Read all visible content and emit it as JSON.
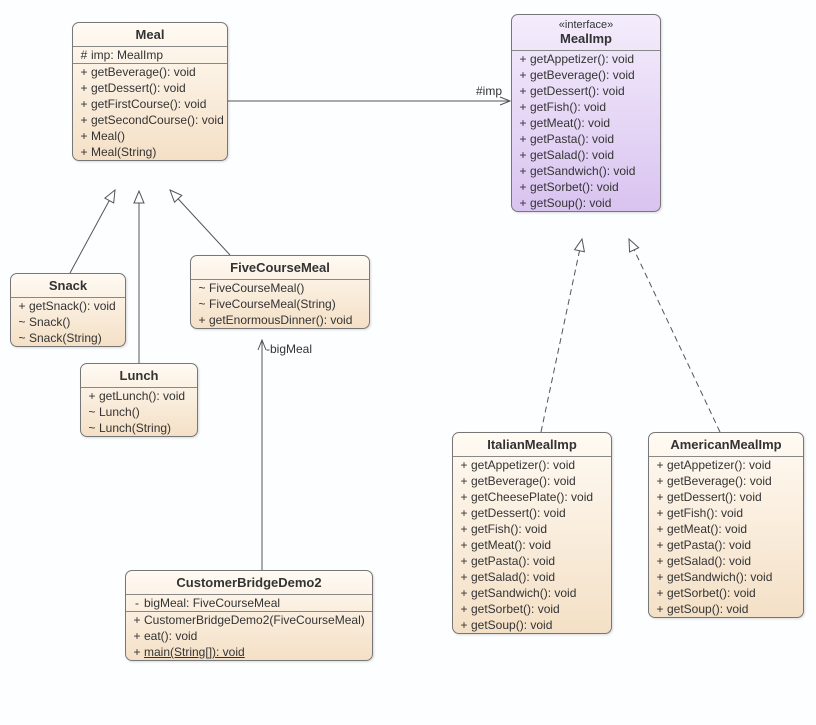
{
  "classes": {
    "meal": {
      "name": "Meal",
      "attrs": [
        {
          "vis": "#",
          "sig": "imp: MealImp"
        }
      ],
      "ops": [
        {
          "vis": "+",
          "sig": "getBeverage(): void"
        },
        {
          "vis": "+",
          "sig": "getDessert(): void"
        },
        {
          "vis": "+",
          "sig": "getFirstCourse(): void"
        },
        {
          "vis": "+",
          "sig": "getSecondCourse(): void"
        },
        {
          "vis": "+",
          "sig": "Meal()"
        },
        {
          "vis": "+",
          "sig": "Meal(String)"
        }
      ]
    },
    "mealimp": {
      "stereotype": "«interface»",
      "name": "MealImp",
      "ops": [
        {
          "vis": "+",
          "sig": "getAppetizer(): void"
        },
        {
          "vis": "+",
          "sig": "getBeverage(): void"
        },
        {
          "vis": "+",
          "sig": "getDessert(): void"
        },
        {
          "vis": "+",
          "sig": "getFish(): void"
        },
        {
          "vis": "+",
          "sig": "getMeat(): void"
        },
        {
          "vis": "+",
          "sig": "getPasta(): void"
        },
        {
          "vis": "+",
          "sig": "getSalad(): void"
        },
        {
          "vis": "+",
          "sig": "getSandwich(): void"
        },
        {
          "vis": "+",
          "sig": "getSorbet(): void"
        },
        {
          "vis": "+",
          "sig": "getSoup(): void"
        }
      ]
    },
    "snack": {
      "name": "Snack",
      "ops": [
        {
          "vis": "+",
          "sig": "getSnack(): void"
        },
        {
          "vis": "~",
          "sig": "Snack()"
        },
        {
          "vis": "~",
          "sig": "Snack(String)"
        }
      ]
    },
    "fivecoursemeal": {
      "name": "FiveCourseMeal",
      "ops": [
        {
          "vis": "~",
          "sig": "FiveCourseMeal()"
        },
        {
          "vis": "~",
          "sig": "FiveCourseMeal(String)"
        },
        {
          "vis": "+",
          "sig": "getEnormousDinner(): void"
        }
      ]
    },
    "lunch": {
      "name": "Lunch",
      "ops": [
        {
          "vis": "+",
          "sig": "getLunch(): void"
        },
        {
          "vis": "~",
          "sig": "Lunch()"
        },
        {
          "vis": "~",
          "sig": "Lunch(String)"
        }
      ]
    },
    "italian": {
      "name": "ItalianMealImp",
      "ops": [
        {
          "vis": "+",
          "sig": "getAppetizer(): void"
        },
        {
          "vis": "+",
          "sig": "getBeverage(): void"
        },
        {
          "vis": "+",
          "sig": "getCheesePlate(): void"
        },
        {
          "vis": "+",
          "sig": "getDessert(): void"
        },
        {
          "vis": "+",
          "sig": "getFish(): void"
        },
        {
          "vis": "+",
          "sig": "getMeat(): void"
        },
        {
          "vis": "+",
          "sig": "getPasta(): void"
        },
        {
          "vis": "+",
          "sig": "getSalad(): void"
        },
        {
          "vis": "+",
          "sig": "getSandwich(): void"
        },
        {
          "vis": "+",
          "sig": "getSorbet(): void"
        },
        {
          "vis": "+",
          "sig": "getSoup(): void"
        }
      ]
    },
    "american": {
      "name": "AmericanMealImp",
      "ops": [
        {
          "vis": "+",
          "sig": "getAppetizer(): void"
        },
        {
          "vis": "+",
          "sig": "getBeverage(): void"
        },
        {
          "vis": "+",
          "sig": "getDessert(): void"
        },
        {
          "vis": "+",
          "sig": "getFish(): void"
        },
        {
          "vis": "+",
          "sig": "getMeat(): void"
        },
        {
          "vis": "+",
          "sig": "getPasta(): void"
        },
        {
          "vis": "+",
          "sig": "getSalad(): void"
        },
        {
          "vis": "+",
          "sig": "getSandwich(): void"
        },
        {
          "vis": "+",
          "sig": "getSorbet(): void"
        },
        {
          "vis": "+",
          "sig": "getSoup(): void"
        }
      ]
    },
    "customer": {
      "name": "CustomerBridgeDemo2",
      "attrs": [
        {
          "vis": "-",
          "sig": "bigMeal: FiveCourseMeal"
        }
      ],
      "ops": [
        {
          "vis": "+",
          "sig": "CustomerBridgeDemo2(FiveCourseMeal)"
        },
        {
          "vis": "+",
          "sig": "eat(): void"
        },
        {
          "vis": "+",
          "sig": "main(String[]): void",
          "static": true
        }
      ]
    }
  },
  "labels": {
    "imp": "#imp",
    "bigmeal": "-bigMeal"
  }
}
